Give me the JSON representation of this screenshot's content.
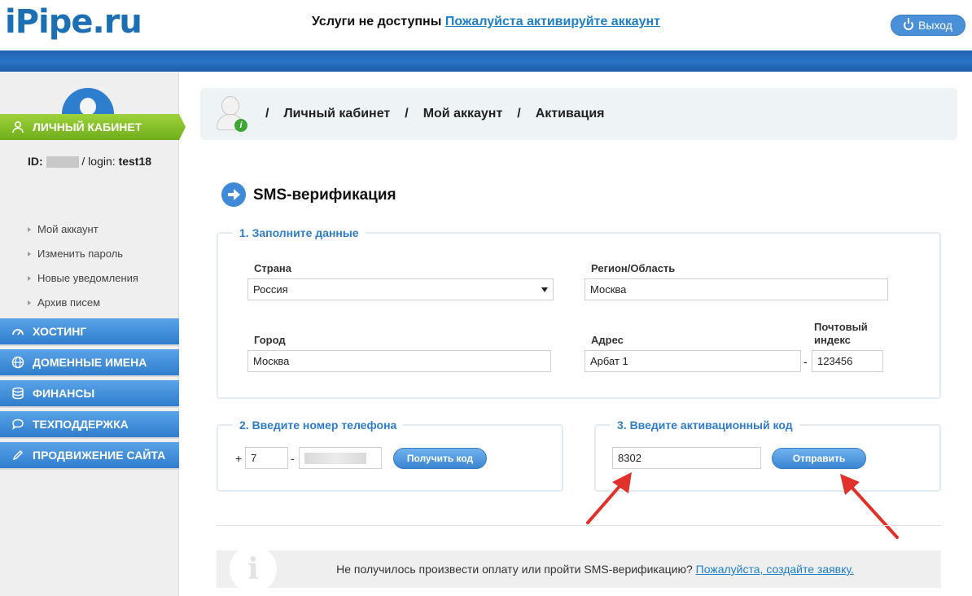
{
  "header": {
    "logo": "iPipe.ru",
    "notice_text": "Услуги не доступны",
    "notice_link": "Пожалуйста активируйте аккаунт",
    "logout_label": "Выход"
  },
  "user": {
    "id_label": "ID:",
    "login_label": "/ login:",
    "login_value": "test18"
  },
  "sidebar": {
    "active": "ЛИЧНЫЙ КАБИНЕТ",
    "subitems": [
      "Мой аккаунт",
      "Изменить пароль",
      "Новые уведомления",
      "Архив писем"
    ],
    "sections": [
      "ХОСТИНГ",
      "ДОМЕННЫЕ ИМЕНА",
      "ФИНАНСЫ",
      "ТЕХПОДДЕРЖКА",
      "ПРОДВИЖЕНИЕ САЙТА"
    ]
  },
  "breadcrumb": {
    "sep": "/",
    "items": [
      "Личный кабинет",
      "Мой аккаунт",
      "Активация"
    ]
  },
  "page_title": "SMS-верификация",
  "step1": {
    "legend": "1. Заполните данные",
    "country_label": "Страна",
    "country_value": "Россия",
    "region_label": "Регион/Область",
    "region_value": "Москва",
    "city_label": "Город",
    "city_value": "Москва",
    "address_label": "Адрес",
    "address_value": "Арбат 1",
    "postal_label_1": "Почтовый",
    "postal_label_2": "индекс",
    "postal_value": "123456",
    "dash": "-"
  },
  "step2": {
    "legend": "2. Введите номер телефона",
    "plus": "+",
    "code_value": "7",
    "dash": "-",
    "button": "Получить код"
  },
  "step3": {
    "legend": "3. Введите активационный код",
    "code_value": "8302",
    "button": "Отправить"
  },
  "info": {
    "icon": "i",
    "text": "Не получилось произвести оплату или пройти SMS-верификацию?",
    "link": "Пожалуйста, создайте заявку."
  },
  "colors": {
    "brand": "#1d6fb3",
    "active_nav": "#8cc63f",
    "nav_blue": "#3f8ad8",
    "arrow_red": "#e0312b"
  }
}
